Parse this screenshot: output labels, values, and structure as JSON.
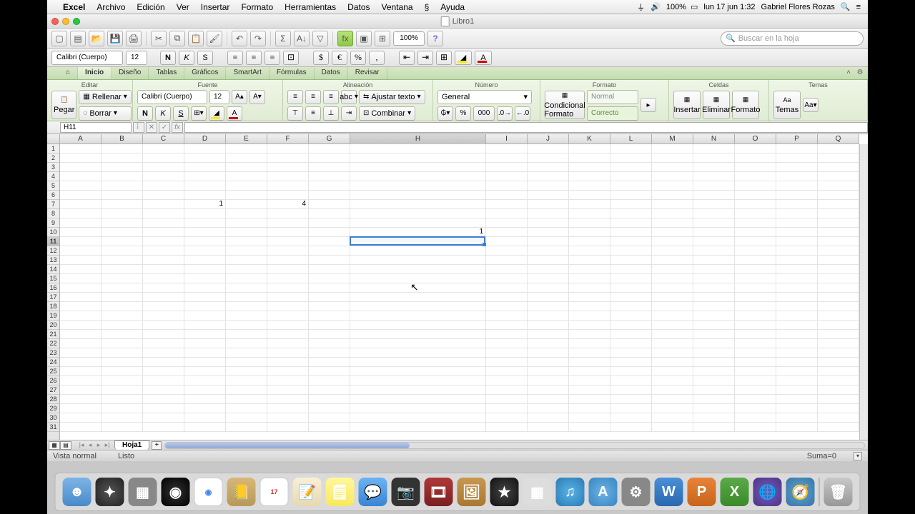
{
  "menubar": {
    "app": "Excel",
    "items": [
      "Archivo",
      "Edición",
      "Ver",
      "Insertar",
      "Formato",
      "Herramientas",
      "Datos",
      "Ventana"
    ],
    "help": "Ayuda",
    "battery": "100%",
    "date": "lun 17 jun  1:32",
    "user": "Gabriel Flores Rozas"
  },
  "window": {
    "title": "Libro1"
  },
  "toolbar": {
    "zoom": "100%",
    "search_placeholder": "Buscar en la hoja"
  },
  "fontbar": {
    "font": "Calibri (Cuerpo)",
    "size": "12",
    "bold": "N",
    "italic": "K",
    "strike": "S"
  },
  "ribbon": {
    "tabs": [
      "Inicio",
      "Diseño",
      "Tablas",
      "Gráficos",
      "SmartArt",
      "Fórmulas",
      "Datos",
      "Revisar"
    ],
    "active": "Inicio",
    "groups": {
      "editar": {
        "title": "Editar",
        "paste": "Pegar",
        "fill": "Rellenar",
        "clear": "Borrar"
      },
      "fuente": {
        "title": "Fuente",
        "font": "Calibri (Cuerpo)",
        "size": "12",
        "bold": "N",
        "italic": "K",
        "underline": "S"
      },
      "alineacion": {
        "title": "Alineación",
        "wrap": "Ajustar texto",
        "merge": "Combinar",
        "abc": "abc"
      },
      "numero": {
        "title": "Número",
        "format": "General",
        "pct": "%",
        "thousands": "000"
      },
      "formato": {
        "title": "Formato",
        "conditional": "Condicional Formato",
        "style_normal": "Normal",
        "style_good": "Correcto"
      },
      "celdas": {
        "title": "Celdas",
        "insert": "Insertar",
        "delete": "Eliminar",
        "format": "Formato"
      },
      "temas": {
        "title": "Temas",
        "label": "Temas"
      }
    }
  },
  "formulabar": {
    "cell_ref": "H11",
    "fx": "fx"
  },
  "grid": {
    "columns": [
      "A",
      "B",
      "C",
      "D",
      "E",
      "F",
      "G",
      "H",
      "I",
      "J",
      "K",
      "L",
      "M",
      "N",
      "O",
      "P",
      "Q"
    ],
    "selected_col": "H",
    "selected_row": 11,
    "row_count": 31,
    "cells": {
      "D7": "1",
      "F7": "4",
      "H10": "1"
    }
  },
  "sheetbar": {
    "sheet": "Hoja1"
  },
  "statusbar": {
    "view": "Vista normal",
    "ready": "Listo",
    "sum": "Suma=0"
  },
  "dock_icons": [
    "finder",
    "dashboard",
    "activity",
    "safari",
    "chrome",
    "preview",
    "calendar",
    "reminders",
    "notes",
    "messages",
    "facetime",
    "photobooth",
    "iphoto",
    "imovie",
    "numbers",
    "itunes",
    "appstore",
    "settings",
    "word",
    "powerpoint",
    "excel",
    "globe",
    "quicktime",
    "trash"
  ]
}
